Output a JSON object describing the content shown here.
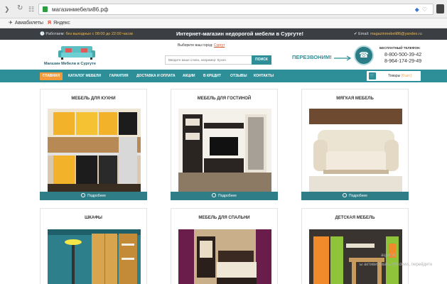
{
  "browser": {
    "url": "магазинмебели86.рф",
    "bookmarks": [
      "Авиабилеты",
      "Яндекс"
    ]
  },
  "topstrip": {
    "hours_label": "Работаем:",
    "hours_value": "без выходных с 08:00 до 22:00 часов",
    "headline": "Интернет-магазин недорогой мебели в Сургуте!",
    "email_label": "Email:",
    "email_value": "magazinmebeli86@yandex.ru"
  },
  "header": {
    "logo_text": "Магазин Мебели в Сургуте",
    "city_prompt": "Выберите ваш город:",
    "city": "Сургут",
    "search_placeholder": "Введите ваше слово, например: Кухня",
    "search_button": "ПОИСК",
    "callback": "ПЕРЕЗВОНИМ!",
    "free_call_label": "БЕСПЛАТНЫЙ ТЕЛЕФОН:",
    "phone1": "8-800-500-39-42",
    "phone2": "8-964-174-29-49"
  },
  "nav": {
    "items": [
      "ГЛАВНАЯ",
      "КАТАЛОГ МЕБЕЛИ",
      "ГАРАНТИЯ",
      "ДОСТАВКА И ОПЛАТА",
      "АКЦИИ",
      "В КРЕДИТ",
      "ОТЗЫВЫ",
      "КОНТАКТЫ"
    ],
    "active_index": 0,
    "cart_label": "Товары",
    "cart_count": "(0 шт.)"
  },
  "products": [
    {
      "title": "МЕБЕЛЬ ДЛЯ КУХНИ",
      "button": "Подробнее"
    },
    {
      "title": "МЕБЕЛЬ ДЛЯ ГОСТИНОЙ",
      "button": "Подробнее"
    },
    {
      "title": "МЯГКАЯ МЕБЕЛЬ",
      "button": "Подробнее"
    },
    {
      "title": "ШКАФЫ"
    },
    {
      "title": "МЕБЕЛЬ ДЛЯ СПАЛЬНИ"
    },
    {
      "title": "ДЕТСКАЯ МЕБЕЛЬ"
    }
  ],
  "watermark": {
    "line1": "ация W",
    "line2": "ы активировать Windows, перейдите"
  },
  "colors": {
    "teal": "#2e8f98",
    "orange": "#f39a3d",
    "dark": "#3b3f44"
  }
}
